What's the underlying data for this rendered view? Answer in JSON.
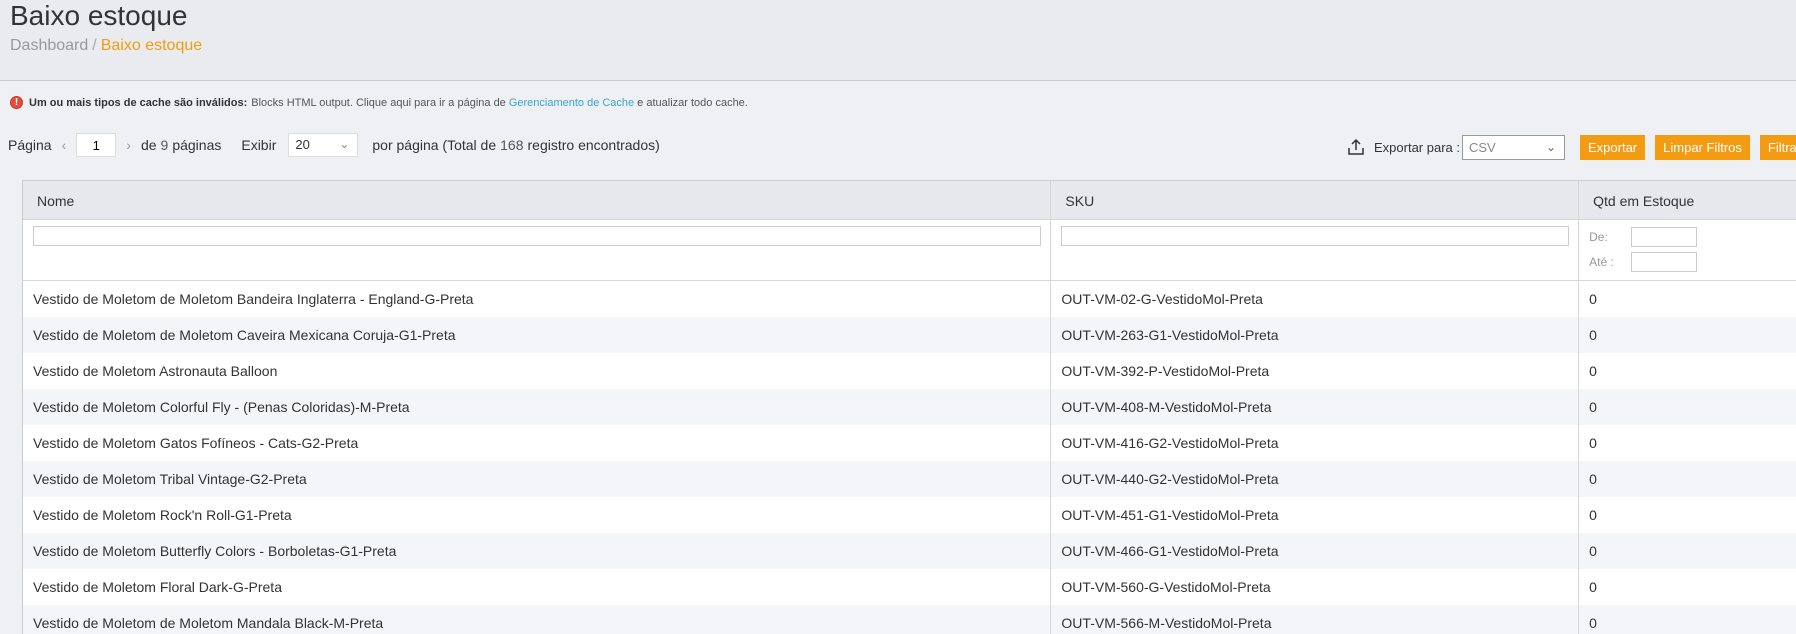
{
  "header": {
    "title": "Baixo estoque",
    "breadcrumb_root": "Dashboard",
    "breadcrumb_sep": "/",
    "breadcrumb_current": "Baixo estoque"
  },
  "notice": {
    "icon": "!",
    "bold": "Um ou mais tipos de cache são inválidos:",
    "text1": "Blocks HTML output. Clique aqui para ir a página de",
    "link": "Gerenciamento de Cache",
    "text2": "e atualizar todo cache."
  },
  "pager": {
    "label_page": "Página",
    "prev": "‹",
    "current_page": "1",
    "next": "›",
    "of_label": "de",
    "total_pages": "9",
    "pages_label": "páginas",
    "show_label": "Exibir",
    "per_page": "20",
    "per_page_label": "por página (Total de",
    "total_records": "168",
    "records_label": "registro encontrados)"
  },
  "export": {
    "label": "Exportar para :",
    "format": "CSV",
    "export_button": "Exportar",
    "clear_filters_button": "Limpar Filtros",
    "filter_button": "Filtrar"
  },
  "grid": {
    "columns": [
      "Nome",
      "SKU",
      "Qtd em Estoque"
    ],
    "range_from": "De:",
    "range_to": "Até :",
    "rows": [
      {
        "nome": "Vestido de Moletom de Moletom Bandeira Inglaterra - England-G-Preta",
        "sku": "OUT-VM-02-G-VestidoMol-Preta",
        "qtd": "0"
      },
      {
        "nome": "Vestido de Moletom de Moletom Caveira Mexicana Coruja-G1-Preta",
        "sku": "OUT-VM-263-G1-VestidoMol-Preta",
        "qtd": "0"
      },
      {
        "nome": "Vestido de Moletom Astronauta Balloon",
        "sku": "OUT-VM-392-P-VestidoMol-Preta",
        "qtd": "0"
      },
      {
        "nome": "Vestido de Moletom Colorful Fly - (Penas Coloridas)-M-Preta",
        "sku": "OUT-VM-408-M-VestidoMol-Preta",
        "qtd": "0"
      },
      {
        "nome": "Vestido de Moletom Gatos Fofíneos - Cats-G2-Preta",
        "sku": "OUT-VM-416-G2-VestidoMol-Preta",
        "qtd": "0"
      },
      {
        "nome": "Vestido de Moletom Tribal Vintage-G2-Preta",
        "sku": "OUT-VM-440-G2-VestidoMol-Preta",
        "qtd": "0"
      },
      {
        "nome": "Vestido de Moletom Rock'n Roll-G1-Preta",
        "sku": "OUT-VM-451-G1-VestidoMol-Preta",
        "qtd": "0"
      },
      {
        "nome": "Vestido de Moletom Butterfly Colors - Borboletas-G1-Preta",
        "sku": "OUT-VM-466-G1-VestidoMol-Preta",
        "qtd": "0"
      },
      {
        "nome": "Vestido de Moletom Floral Dark-G-Preta",
        "sku": "OUT-VM-560-G-VestidoMol-Preta",
        "qtd": "0"
      },
      {
        "nome": "Vestido de Moletom de Moletom Mandala Black-M-Preta",
        "sku": "OUT-VM-566-M-VestidoMol-Preta",
        "qtd": "0"
      }
    ]
  },
  "colors": {
    "accent": "#f39c12",
    "link": "#3aa6d0",
    "warning": "#e74c3c"
  }
}
